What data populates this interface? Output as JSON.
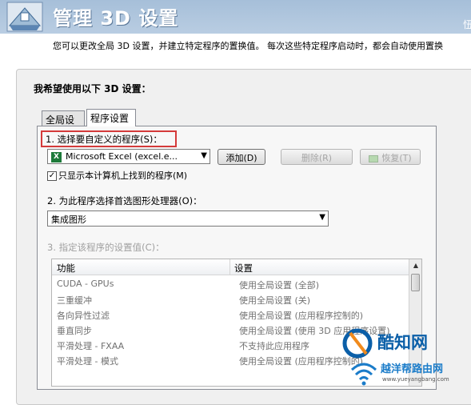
{
  "header": {
    "title": "管理 3D 设置",
    "right_fragment": "忸"
  },
  "description": "您可以更改全局 3D 设置，并建立特定程序的置换值。 每次这些特定程序启动时，都会自动使用置换",
  "section_title": "我希望使用以下 3D 设置：",
  "tabs": [
    {
      "label": "全局设置",
      "active": false
    },
    {
      "label": "程序设置",
      "active": true
    }
  ],
  "step1": {
    "label": "1. 选择要自定义的程序(S)：",
    "program_icon": "excel-icon",
    "program_value": "Microsoft Excel (excel.e...",
    "add_button": "添加(D)",
    "remove_button": "删除(R)",
    "restore_button": "恢复(T)",
    "show_only_checkbox": "只显示本计算机上找到的程序(M)",
    "show_only_checked": true
  },
  "step2": {
    "label": "2. 为此程序选择首选图形处理器(O)：",
    "value": "集成图形"
  },
  "step3": {
    "label": "3. 指定该程序的设置值(C)：",
    "columns": [
      "功能",
      "设置"
    ],
    "rows": [
      {
        "feature": "CUDA - GPUs",
        "setting": "使用全局设置 (全部)"
      },
      {
        "feature": "三重缓冲",
        "setting": "使用全局设置 (关)"
      },
      {
        "feature": "各向异性过滤",
        "setting": "使用全局设置 (应用程序控制的)"
      },
      {
        "feature": "垂直同步",
        "setting": "使用全局设置 (使用 3D 应用程序设置)"
      },
      {
        "feature": "平滑处理 - FXAA",
        "setting": "不支持此应用程序"
      },
      {
        "feature": "平滑处理 - 模式",
        "setting": "使用全局设置 (应用程序控制的)"
      }
    ]
  },
  "watermark": {
    "name": "酷知网",
    "subtitle": "越洋帮路由网",
    "url": "www.yueyangbang.com"
  },
  "colors": {
    "header_bg": "#a6bfd9",
    "highlight_box": "#d43a3a",
    "watermark_blue": "#0b5fa8"
  }
}
